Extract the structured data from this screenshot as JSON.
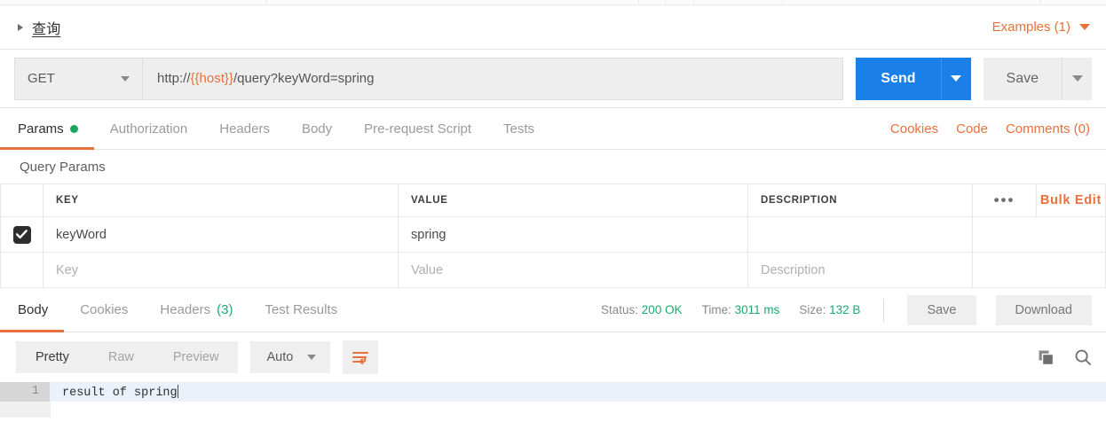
{
  "request": {
    "title": "查询",
    "examples_label": "Examples (1)",
    "method": "GET",
    "url_prefix": "http://",
    "url_variable": "{{host}}",
    "url_suffix": "/query?keyWord=spring",
    "url_full": "http://{{host}}/query?keyWord=spring",
    "send_label": "Send",
    "save_label": "Save",
    "tabs": [
      {
        "label": "Params",
        "active": true,
        "dot": true
      },
      {
        "label": "Authorization",
        "active": false,
        "dot": false
      },
      {
        "label": "Headers",
        "active": false,
        "dot": false
      },
      {
        "label": "Body",
        "active": false,
        "dot": false
      },
      {
        "label": "Pre-request Script",
        "active": false,
        "dot": false
      },
      {
        "label": "Tests",
        "active": false,
        "dot": false
      }
    ],
    "links": [
      {
        "label": "Cookies"
      },
      {
        "label": "Code"
      },
      {
        "label": "Comments (0)"
      }
    ]
  },
  "params": {
    "section_title": "Query Params",
    "columns": [
      "KEY",
      "VALUE",
      "DESCRIPTION"
    ],
    "more_label": "•••",
    "bulk_edit_label": "Bulk Edit",
    "rows": [
      {
        "checked": true,
        "key": "keyWord",
        "value": "spring",
        "description": ""
      }
    ],
    "placeholder_row": {
      "key": "Key",
      "value": "Value",
      "description": "Description"
    }
  },
  "response": {
    "tabs": [
      {
        "label": "Body",
        "active": true,
        "badge": ""
      },
      {
        "label": "Cookies",
        "active": false,
        "badge": ""
      },
      {
        "label": "Headers",
        "active": false,
        "badge": "(3)"
      },
      {
        "label": "Test Results",
        "active": false,
        "badge": ""
      }
    ],
    "status_label": "Status:",
    "status_value": "200 OK",
    "time_label": "Time:",
    "time_value": "3011 ms",
    "size_label": "Size:",
    "size_value": "132 B",
    "save_label": "Save",
    "download_label": "Download",
    "view_modes": [
      {
        "label": "Pretty",
        "active": true
      },
      {
        "label": "Raw",
        "active": false
      },
      {
        "label": "Preview",
        "active": false
      }
    ],
    "format_selected": "Auto",
    "body_lines": [
      {
        "number": "1",
        "text": "result of spring"
      }
    ]
  },
  "colors": {
    "accent_orange": "#e8703a",
    "send_blue": "#1a7fe8",
    "status_green": "#1aab6e",
    "dot_green": "#17a85b"
  }
}
